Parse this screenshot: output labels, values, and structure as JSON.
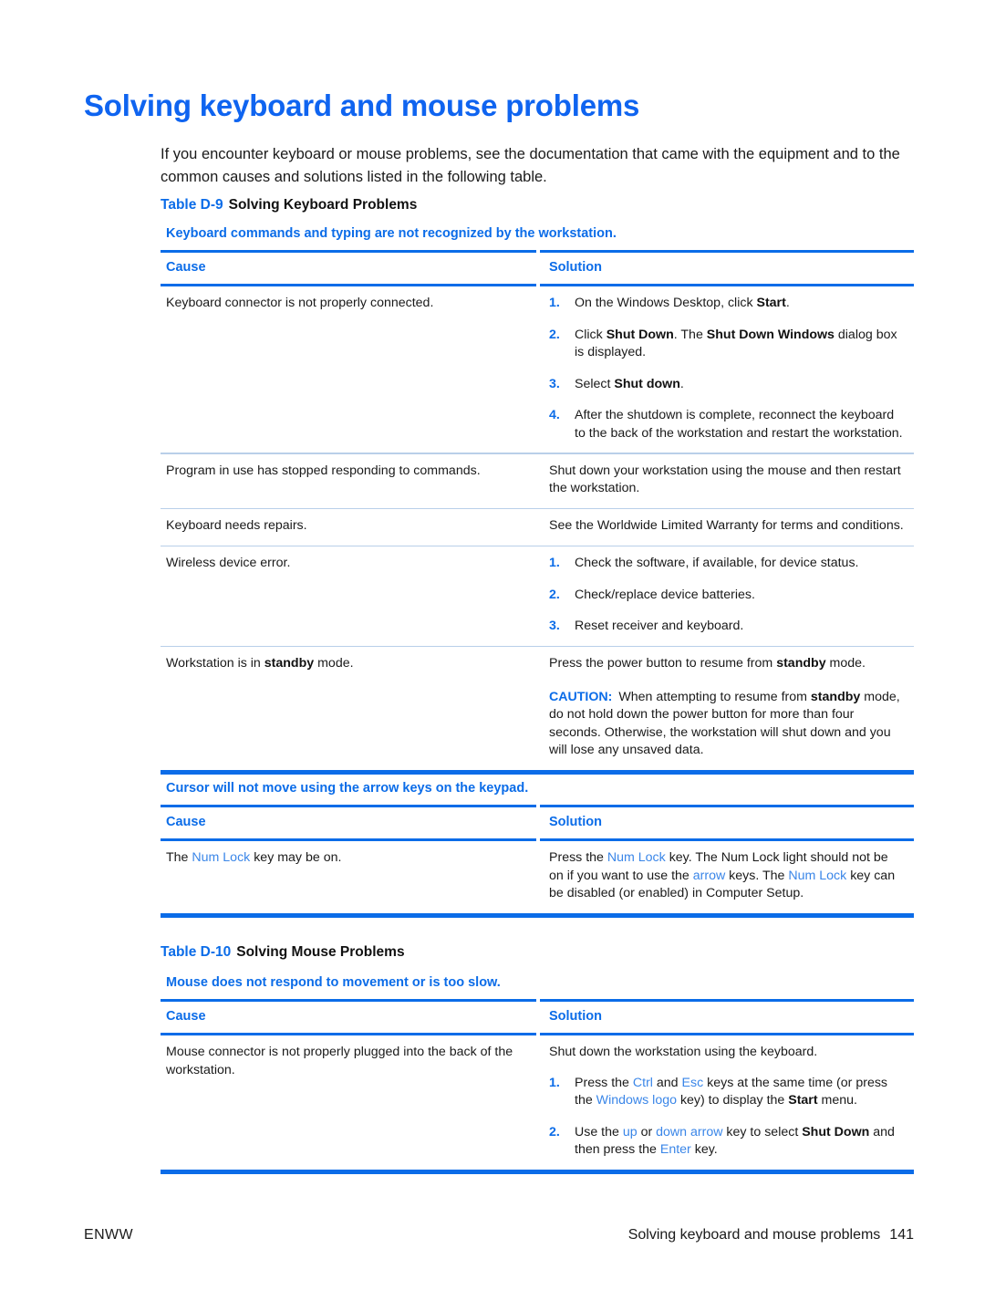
{
  "document": {
    "title": "Solving keyboard and mouse problems",
    "intro": "If you encounter keyboard or mouse problems, see the documentation that came with the equipment and to the common causes and solutions listed in the following table.",
    "accent_blue": "#0b6ce8",
    "title_blue": "#0f64f0",
    "link_blue": "#3a86e8",
    "text_color": "#1a1a1a"
  },
  "tables": {
    "d9": {
      "caption_label": "Table D-9",
      "caption_text": "Solving Keyboard Problems",
      "sections": [
        {
          "condition": "Keyboard commands and typing are not recognized by the workstation.",
          "headers": {
            "cause": "Cause",
            "solution": "Solution"
          },
          "rows": [
            {
              "cause": "Keyboard connector is not properly connected.",
              "steps": [
                {
                  "num": "1.",
                  "text": "On the Windows Desktop, click Start."
                },
                {
                  "num": "2.",
                  "text": "Click Shut Down. The Shut Down Windows dialog box is displayed."
                },
                {
                  "num": "3.",
                  "text": "Select Shut down."
                },
                {
                  "num": "4.",
                  "text": "After the shutdown is complete, reconnect the keyboard to the back of the workstation and restart the workstation."
                }
              ]
            },
            {
              "cause": "Program in use has stopped responding to commands.",
              "solution": "Shut down your workstation using the mouse and then restart the workstation."
            },
            {
              "cause": "Keyboard needs repairs.",
              "solution": "See the Worldwide Limited Warranty for terms and conditions."
            },
            {
              "cause": "Wireless device error.",
              "steps": [
                {
                  "num": "1.",
                  "text": "Check the software, if available, for device status."
                },
                {
                  "num": "2.",
                  "text": "Check/replace device batteries."
                },
                {
                  "num": "3.",
                  "text": "Reset receiver and keyboard."
                }
              ]
            },
            {
              "cause": "Workstation is in standby mode.",
              "solution": "Press the power button to resume from standby mode.",
              "caution_label": "CAUTION:",
              "caution_text": "When attempting to resume from standby mode, do not hold down the power button for more than four seconds. Otherwise, the workstation will shut down and you will lose any unsaved data."
            }
          ]
        },
        {
          "condition": "Cursor will not move using the arrow keys on the keypad.",
          "headers": {
            "cause": "Cause",
            "solution": "Solution"
          },
          "rows": [
            {
              "cause": "The Num Lock key may be on.",
              "solution": "Press the Num Lock key. The Num Lock light should not be on if you want to use the arrow keys. The Num Lock key can be disabled (or enabled) in Computer Setup."
            }
          ]
        }
      ]
    },
    "d10": {
      "caption_label": "Table D-10",
      "caption_text": "Solving Mouse Problems",
      "sections": [
        {
          "condition": "Mouse does not respond to movement or is too slow.",
          "headers": {
            "cause": "Cause",
            "solution": "Solution"
          },
          "rows": [
            {
              "cause": "Mouse connector is not properly plugged into the back of the workstation.",
              "solution": "Shut down the workstation using the keyboard.",
              "steps": [
                {
                  "num": "1.",
                  "text": "Press the Ctrl and Esc keys at the same time (or press the Windows logo key) to display the Start menu."
                },
                {
                  "num": "2.",
                  "text": "Use the up or down arrow key to select Shut Down and then press the Enter key."
                }
              ]
            }
          ]
        }
      ]
    }
  },
  "footer": {
    "left": "ENWW",
    "chapter": "Solving keyboard and mouse problems",
    "page_number": "141"
  }
}
